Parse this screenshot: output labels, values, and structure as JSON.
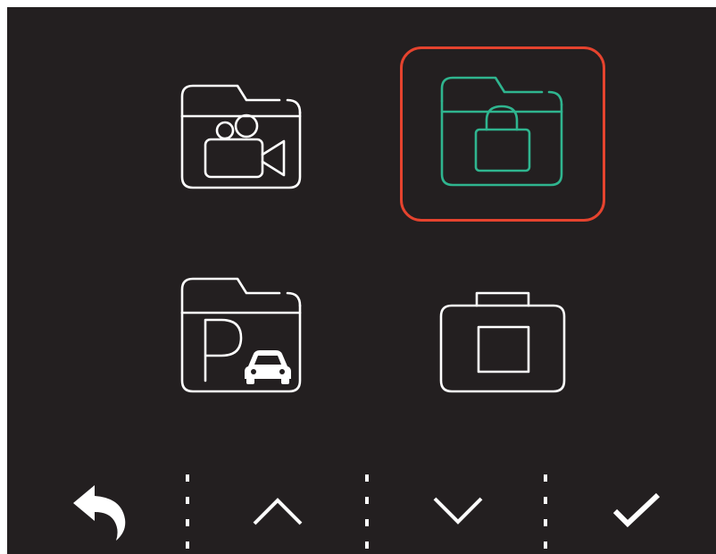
{
  "menu": {
    "selected_index": 1,
    "items": [
      {
        "key": "video",
        "icon": "video-folder-icon"
      },
      {
        "key": "locked",
        "icon": "locked-folder-icon"
      },
      {
        "key": "parking",
        "icon": "parking-folder-icon"
      },
      {
        "key": "photo",
        "icon": "photo-camera-icon"
      }
    ]
  },
  "controls": [
    {
      "key": "back",
      "icon": "back-arrow-icon"
    },
    {
      "key": "up",
      "icon": "chevron-up-icon"
    },
    {
      "key": "down",
      "icon": "chevron-down-icon"
    },
    {
      "key": "confirm",
      "icon": "checkmark-icon"
    }
  ],
  "colors": {
    "background": "#231f20",
    "icon_default": "#ffffff",
    "icon_selected": "#2fb58f",
    "selection_border": "#e5432e"
  }
}
